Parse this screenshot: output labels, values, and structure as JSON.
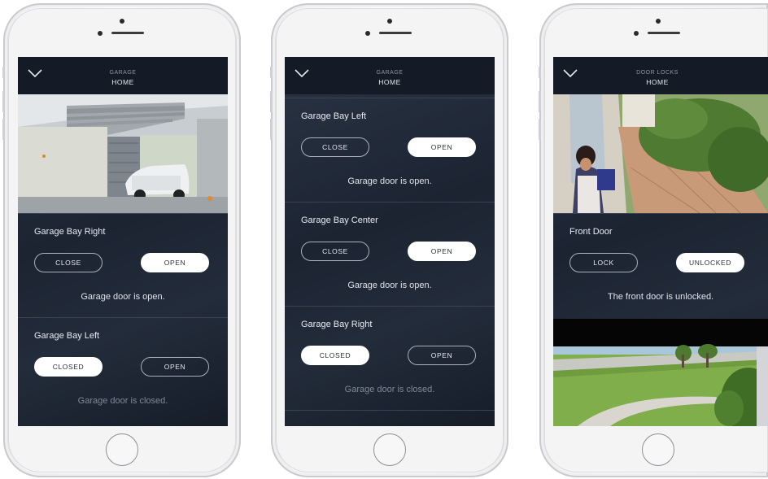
{
  "phones": [
    {
      "nav": {
        "subtitle": "GARAGE",
        "title": "HOME"
      },
      "cards": [
        {
          "name": "Garage Bay Right",
          "close_label": "CLOSE",
          "open_label": "OPEN",
          "active": "open",
          "status": "Garage door is open."
        },
        {
          "name": "Garage Bay Left",
          "close_label": "CLOSED",
          "open_label": "OPEN",
          "active": "closed",
          "status": "Garage door is closed."
        }
      ]
    },
    {
      "nav": {
        "subtitle": "GARAGE",
        "title": "HOME"
      },
      "cards": [
        {
          "name": "Garage Bay Left",
          "close_label": "CLOSE",
          "open_label": "OPEN",
          "active": "open",
          "status": "Garage door is open."
        },
        {
          "name": "Garage Bay Center",
          "close_label": "CLOSE",
          "open_label": "OPEN",
          "active": "open",
          "status": "Garage door is open."
        },
        {
          "name": "Garage Bay Right",
          "close_label": "CLOSED",
          "open_label": "OPEN",
          "active": "closed",
          "status": "Garage door is closed."
        }
      ]
    },
    {
      "nav": {
        "subtitle": "DOOR LOCKS",
        "title": "HOME"
      },
      "cards": [
        {
          "name": "Front Door",
          "close_label": "LOCK",
          "open_label": "UNLOCKED",
          "active": "open",
          "status": "The front door is unlocked."
        }
      ]
    }
  ],
  "icons": {
    "back": "chevron-down-icon",
    "home_button": "home-button"
  },
  "colors": {
    "active_pill": "#ffffff",
    "screen_bg": "#1c2432",
    "navbar": "#141b27"
  }
}
